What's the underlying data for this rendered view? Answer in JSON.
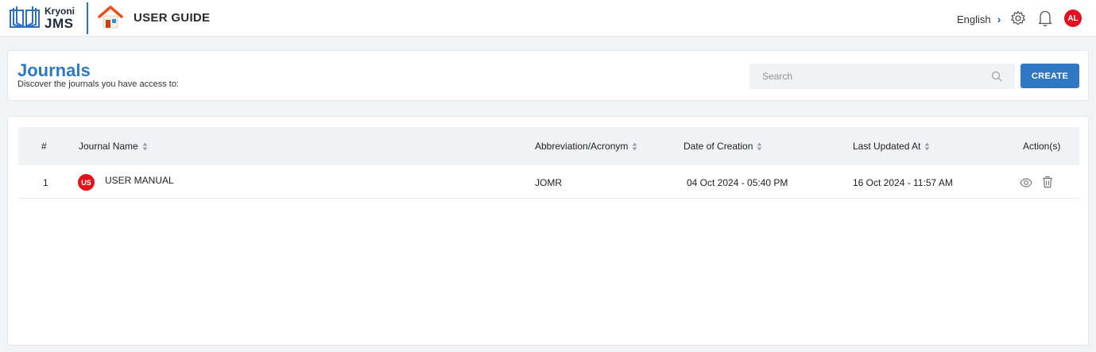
{
  "brand": {
    "name": "Kryoni",
    "product": "JMS"
  },
  "app_title": "USER GUIDE",
  "topbar": {
    "language": "English",
    "language_chevron": "›",
    "user_initials": "AL",
    "icons": [
      "gear-icon",
      "bell-icon"
    ]
  },
  "page": {
    "title": "Journals",
    "subtitle": "Discover the journals you have access to:"
  },
  "search": {
    "placeholder": "Search",
    "value": ""
  },
  "create_label": "CREATE",
  "table": {
    "columns": [
      "#",
      "Journal Name",
      "Abbreviation/Acronym",
      "Date of Creation",
      "Last Updated At",
      "Action(s)"
    ],
    "rows": [
      {
        "index": "1",
        "initials": "US",
        "name": "USER MANUAL",
        "abbreviation": "JOMR",
        "created": "04 Oct 2024 - 05:40 PM",
        "updated": "16 Oct 2024 - 11:57 AM",
        "actions": [
          "eye-icon",
          "trash-icon"
        ]
      }
    ]
  },
  "colors": {
    "accent": "#2f78c4",
    "avatar": "#e3101e",
    "home_roof": "#e8511e"
  }
}
